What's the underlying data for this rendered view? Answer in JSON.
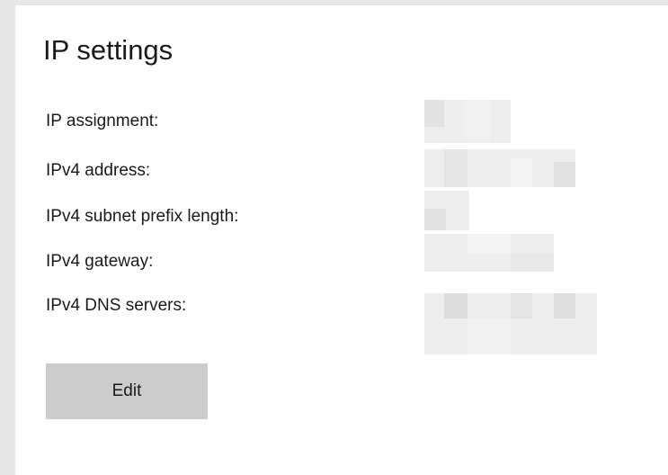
{
  "panel": {
    "title": "IP settings"
  },
  "fields": [
    {
      "label": "IP assignment:"
    },
    {
      "label": "IPv4 address:"
    },
    {
      "label": "IPv4 subnet prefix length:"
    },
    {
      "label": "IPv4 gateway:"
    },
    {
      "label": "IPv4 DNS servers:"
    }
  ],
  "edit_button": {
    "label": "Edit"
  },
  "colors": {
    "page_background": "#e6e6e6",
    "panel_background": "#ffffff",
    "button_background": "#cccccc",
    "text": "#1a1a1a",
    "redacted_value": "#ededed"
  }
}
